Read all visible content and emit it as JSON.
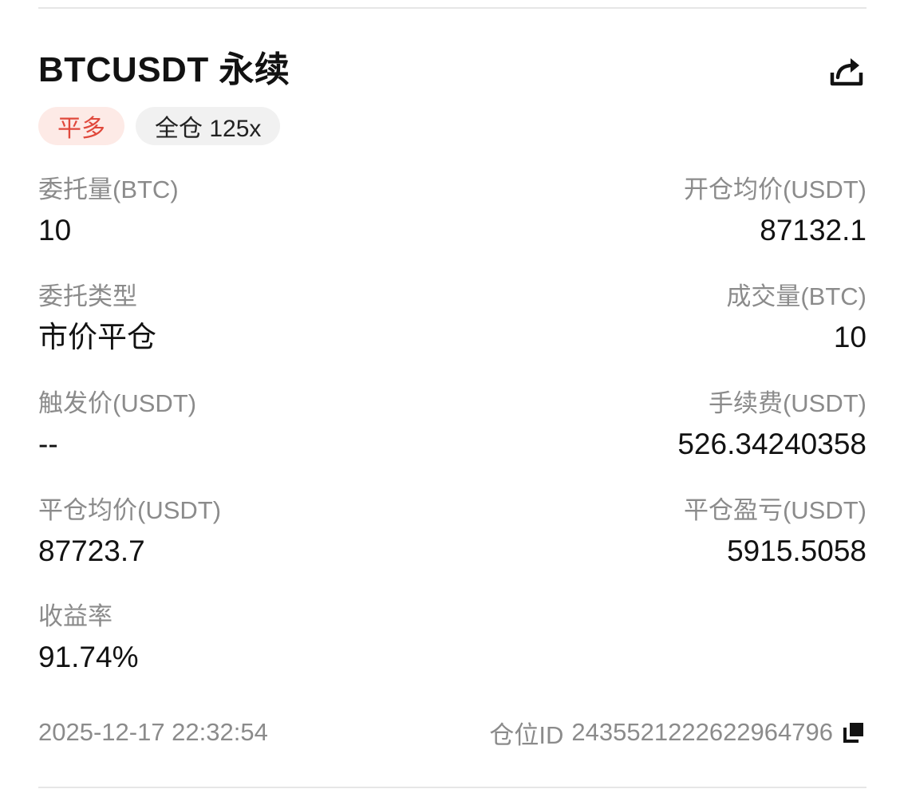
{
  "order": {
    "symbol": "BTCUSDT 永续",
    "tags": {
      "side": "平多",
      "margin": "全仓 125x"
    },
    "fields": {
      "order_qty_label": "委托量(BTC)",
      "order_qty_value": "10",
      "open_avg_label": "开仓均价(USDT)",
      "open_avg_value": "87132.1",
      "order_type_label": "委托类型",
      "order_type_value": "市价平仓",
      "filled_qty_label": "成交量(BTC)",
      "filled_qty_value": "10",
      "trigger_price_label": "触发价(USDT)",
      "trigger_price_value": "--",
      "fee_label": "手续费(USDT)",
      "fee_value": "526.34240358",
      "close_avg_label": "平仓均价(USDT)",
      "close_avg_value": "87723.7",
      "close_pnl_label": "平仓盈亏(USDT)",
      "close_pnl_value": "5915.5058",
      "roi_label": "收益率",
      "roi_value": "91.74%"
    },
    "footer": {
      "time": "2025-12-17 22:32:54",
      "position_id_label": "仓位ID",
      "position_id": "2435521222622964796"
    },
    "icons": {
      "share": "share-icon",
      "copy": "copy-icon"
    },
    "colors": {
      "long_close_text": "#e0483b",
      "long_close_bg": "#fdeae6",
      "label_gray": "#8b8b8b",
      "value_dark": "#121212"
    }
  }
}
